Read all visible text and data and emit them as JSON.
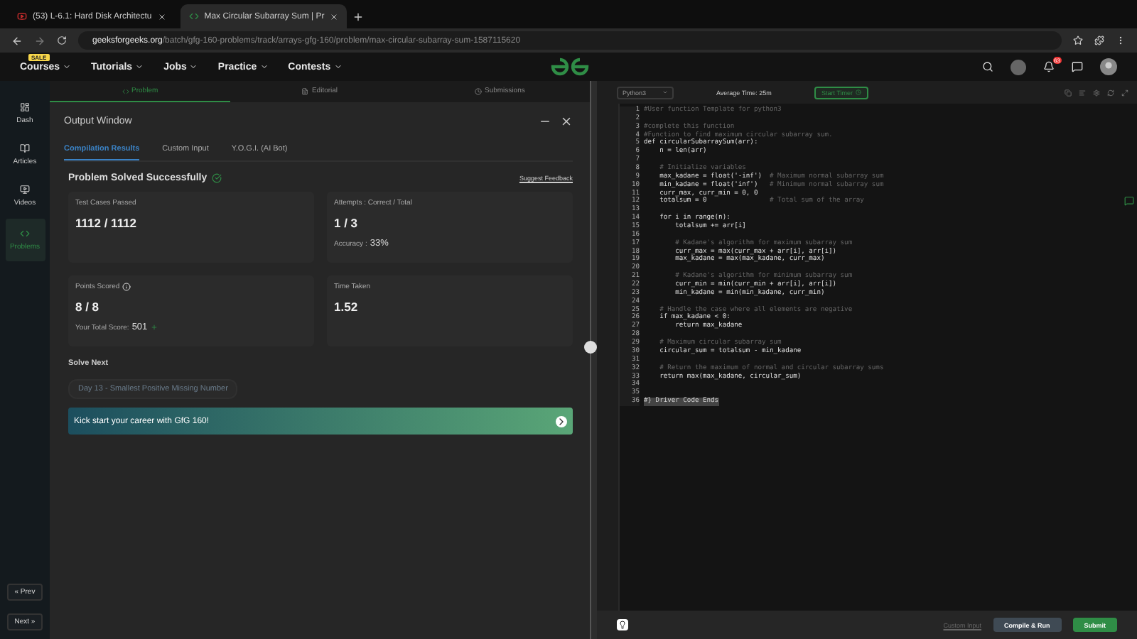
{
  "browser": {
    "tabs": [
      {
        "title": "(53) L-6.1: Hard Disk Architectu",
        "selected": false
      },
      {
        "title": "Max Circular Subarray Sum | Pr",
        "selected": true
      }
    ],
    "url_host": "geeksforgeeks.org",
    "url_path": "/batch/gfg-160-problems/track/arrays-gfg-160/problem/max-circular-subarray-sum-1587115620"
  },
  "site_nav": {
    "sale_badge": "SALE",
    "menus": [
      "Courses",
      "Tutorials",
      "Jobs",
      "Practice",
      "Contests"
    ],
    "notification_count": "63"
  },
  "sidebar": {
    "items": [
      {
        "label": "Dash",
        "selected": false
      },
      {
        "label": "Articles",
        "selected": false
      },
      {
        "label": "Videos",
        "selected": false
      },
      {
        "label": "Problems",
        "selected": true
      }
    ],
    "prev": "« Prev",
    "next": "Next »"
  },
  "problem_tabs": [
    {
      "label": "Problem",
      "selected": true
    },
    {
      "label": "Editorial",
      "selected": false
    },
    {
      "label": "Submissions",
      "selected": false
    }
  ],
  "output_window": {
    "title": "Output Window",
    "tabs": [
      {
        "label": "Compilation Results",
        "selected": true
      },
      {
        "label": "Custom Input",
        "selected": false
      },
      {
        "label": "Y.O.G.I. (AI Bot)",
        "selected": false
      }
    ],
    "status": "Problem Solved Successfully",
    "feedback_link": "Suggest Feedback",
    "cards": [
      {
        "label": "Test Cases Passed",
        "value": "1112 / 1112"
      },
      {
        "label": "Attempts : Correct / Total",
        "value": "1 / 3",
        "note_label": "Accuracy :",
        "note_value": "33%"
      },
      {
        "label": "Points Scored",
        "value": "8 / 8",
        "note_label": "Your Total Score:",
        "note_value": "501",
        "info": true,
        "increase": true
      },
      {
        "label": "Time Taken",
        "value": "1.52"
      }
    ],
    "solve_next_title": "Solve Next",
    "next_problem": "Day 13 - Smallest Positive Missing Number",
    "banner": "Kick start your career with GfG 160!"
  },
  "editor": {
    "language": "Python3",
    "average_time": "Average Time: 25m",
    "timer_button": "Start Timer",
    "lines": [
      {
        "number": "1",
        "comment": "#User function Template for python3"
      },
      {
        "number": "2"
      },
      {
        "number": "3",
        "comment": "#complete this function"
      },
      {
        "number": "4",
        "comment": "#Function to find maximum circular subarray sum."
      },
      {
        "number": "5",
        "code": "def circularSubarraySum(arr):"
      },
      {
        "number": "6",
        "code": "    n = len(arr)"
      },
      {
        "number": "7"
      },
      {
        "number": "8",
        "comment": "    # Initialize variables"
      },
      {
        "number": "9",
        "code": "    max_kadane = float('-inf')  ",
        "comment": "# Maximum normal subarray sum"
      },
      {
        "number": "10",
        "code": "    min_kadane = float('inf')   ",
        "comment": "# Minimum normal subarray sum"
      },
      {
        "number": "11",
        "code": "    curr_max, curr_min = 0, 0"
      },
      {
        "number": "12",
        "code": "    totalsum = 0                ",
        "comment": "# Total sum of the array"
      },
      {
        "number": "13"
      },
      {
        "number": "14",
        "code": "    for i in range(n):"
      },
      {
        "number": "15",
        "code": "        totalsum += arr[i]"
      },
      {
        "number": "16"
      },
      {
        "number": "17",
        "comment": "        # Kadane's algorithm for maximum subarray sum"
      },
      {
        "number": "18",
        "code": "        curr_max = max(curr_max + arr[i], arr[i])"
      },
      {
        "number": "19",
        "code": "        max_kadane = max(max_kadane, curr_max)"
      },
      {
        "number": "20"
      },
      {
        "number": "21",
        "comment": "        # Kadane's algorithm for minimum subarray sum"
      },
      {
        "number": "22",
        "code": "        curr_min = min(curr_min + arr[i], arr[i])"
      },
      {
        "number": "23",
        "code": "        min_kadane = min(min_kadane, curr_min)"
      },
      {
        "number": "24"
      },
      {
        "number": "25",
        "comment": "    # Handle the case where all elements are negative"
      },
      {
        "number": "26",
        "code": "    if max_kadane < 0:"
      },
      {
        "number": "27",
        "code": "        return max_kadane"
      },
      {
        "number": "28"
      },
      {
        "number": "29",
        "comment": "    # Maximum circular subarray sum"
      },
      {
        "number": "30",
        "code": "    circular_sum = totalsum - min_kadane"
      },
      {
        "number": "31"
      },
      {
        "number": "32",
        "comment": "    # Return the maximum of normal and circular subarray sums"
      },
      {
        "number": "33",
        "code": "    return max(max_kadane, circular_sum)"
      },
      {
        "number": "34"
      },
      {
        "number": "35"
      },
      {
        "number": "36",
        "comment": "#} Driver Code Ends",
        "kind": "folded"
      }
    ],
    "custom_input": "Custom Input",
    "compile_button": "Compile & Run",
    "submit_button": "Submit"
  }
}
